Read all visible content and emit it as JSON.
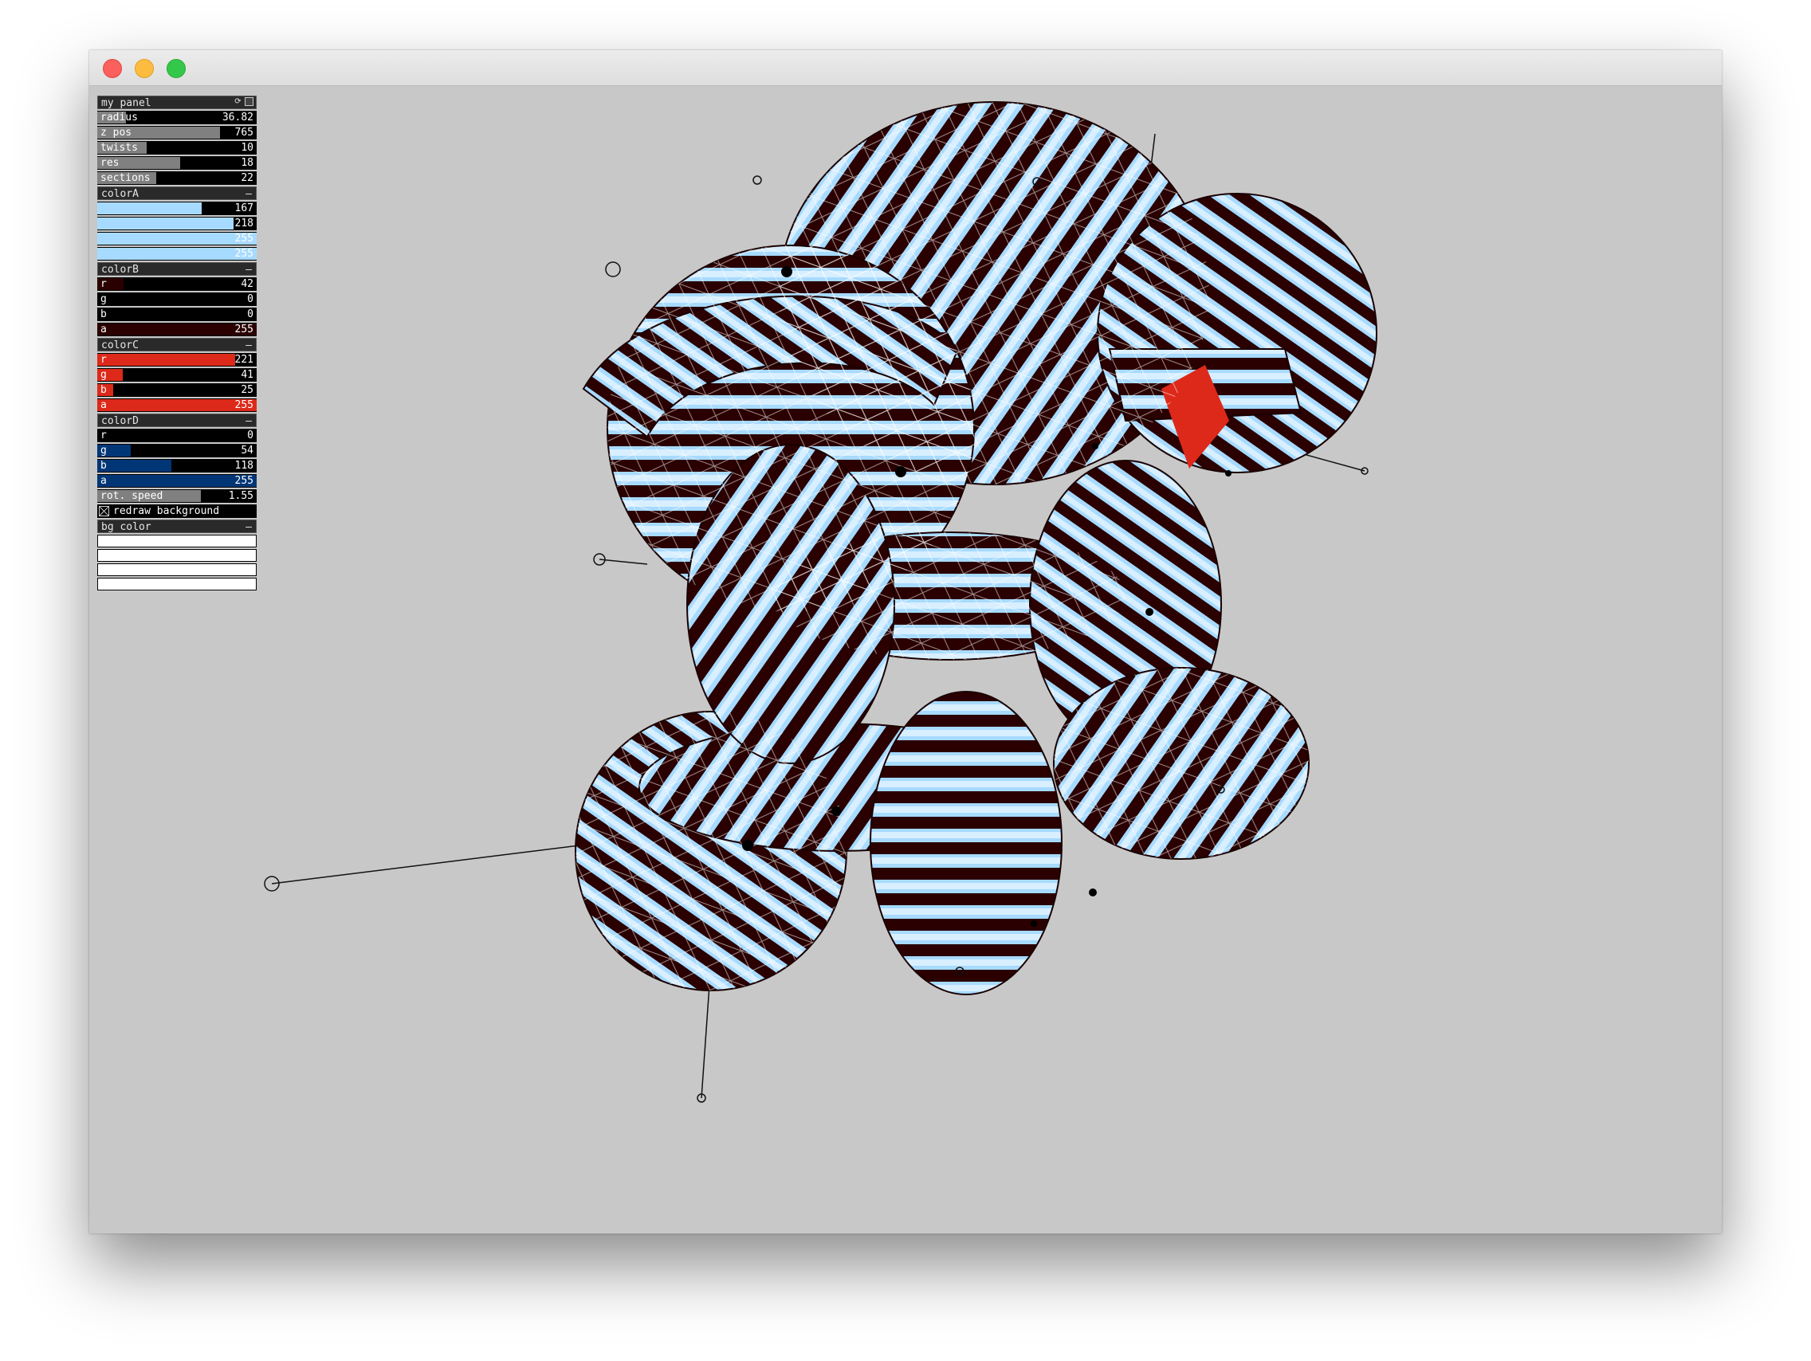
{
  "window": {
    "title": ""
  },
  "panel": {
    "title": "my panel",
    "sliders": [
      {
        "label": "radius",
        "value": "36.82",
        "fraction": 0.18
      },
      {
        "label": "z pos",
        "value": "765",
        "fraction": 0.77
      },
      {
        "label": "twists",
        "value": "10",
        "fraction": 0.31
      },
      {
        "label": "res",
        "value": "18",
        "fraction": 0.52
      },
      {
        "label": "sections",
        "value": "22",
        "fraction": 0.37
      }
    ],
    "color_groups": [
      {
        "name": "colorA",
        "toggle": "–",
        "fill_color": "#a7daff",
        "channels": [
          {
            "label": "r",
            "value": "167",
            "fraction": 0.655
          },
          {
            "label": "g",
            "value": "218",
            "fraction": 0.855
          },
          {
            "label": "b",
            "value": "255",
            "fraction": 1.0
          },
          {
            "label": "a",
            "value": "255",
            "fraction": 1.0
          }
        ]
      },
      {
        "name": "colorB",
        "toggle": "–",
        "fill_color": "#2a0000",
        "channels": [
          {
            "label": "r",
            "value": "42",
            "fraction": 0.165
          },
          {
            "label": "g",
            "value": "0",
            "fraction": 0.0
          },
          {
            "label": "b",
            "value": "0",
            "fraction": 0.0
          },
          {
            "label": "a",
            "value": "255",
            "fraction": 1.0
          }
        ]
      },
      {
        "name": "colorC",
        "toggle": "–",
        "fill_color": "#dd2919",
        "channels": [
          {
            "label": "r",
            "value": "221",
            "fraction": 0.867
          },
          {
            "label": "g",
            "value": "41",
            "fraction": 0.161
          },
          {
            "label": "b",
            "value": "25",
            "fraction": 0.098
          },
          {
            "label": "a",
            "value": "255",
            "fraction": 1.0
          }
        ]
      },
      {
        "name": "colorD",
        "toggle": "–",
        "fill_color": "#003676",
        "channels": [
          {
            "label": "r",
            "value": "0",
            "fraction": 0.0
          },
          {
            "label": "g",
            "value": "54",
            "fraction": 0.212
          },
          {
            "label": "b",
            "value": "118",
            "fraction": 0.463
          },
          {
            "label": "a",
            "value": "255",
            "fraction": 1.0
          }
        ]
      }
    ],
    "rot_speed": {
      "label": "rot. speed",
      "value": "1.55",
      "fraction": 0.65
    },
    "redraw_background": {
      "label": "redraw background",
      "checked": true
    },
    "bg_color": {
      "name": "bg color",
      "toggle": "–"
    }
  },
  "scene": {
    "background": "#c8c8c8",
    "tube_light": "#a7daff",
    "tube_dark": "#2a0000",
    "highlight": "#dd2919"
  },
  "icons": {
    "reload": "reload-icon",
    "save": "save-icon"
  }
}
